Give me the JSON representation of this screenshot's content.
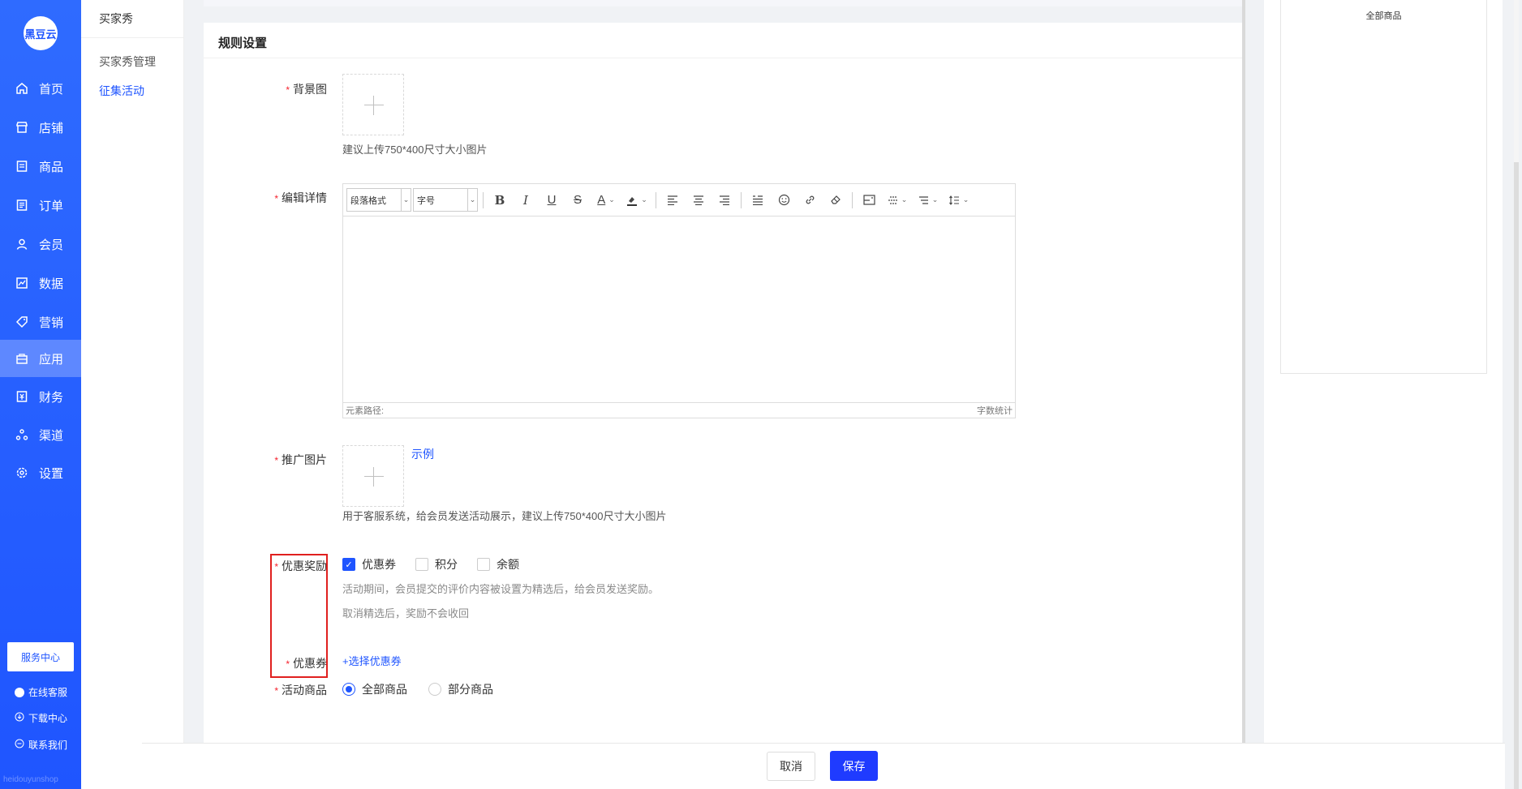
{
  "nav": {
    "logo": "黑豆云",
    "items": [
      {
        "label": "首页",
        "icon": "home-icon"
      },
      {
        "label": "店铺",
        "icon": "store-icon"
      },
      {
        "label": "商品",
        "icon": "goods-icon"
      },
      {
        "label": "订单",
        "icon": "order-icon"
      },
      {
        "label": "会员",
        "icon": "member-icon"
      },
      {
        "label": "数据",
        "icon": "data-icon"
      },
      {
        "label": "营销",
        "icon": "tag-icon"
      },
      {
        "label": "应用",
        "icon": "app-icon",
        "active": true
      },
      {
        "label": "财务",
        "icon": "finance-icon"
      },
      {
        "label": "渠道",
        "icon": "channel-icon"
      },
      {
        "label": "设置",
        "icon": "gear-icon"
      }
    ],
    "service_center": "服务中心",
    "online_service": "在线客服",
    "download_center": "下载中心",
    "contact_us": "联系我们",
    "watermark": "heidouyunshop"
  },
  "subnav": {
    "title": "买家秀",
    "items": [
      {
        "label": "买家秀管理",
        "active": false
      },
      {
        "label": "征集活动",
        "active": true
      }
    ]
  },
  "form": {
    "section_title": "规则设置",
    "background_label": "背景图",
    "background_hint": "建议上传750*400尺寸大小图片",
    "detail_label": "编辑详情",
    "editor": {
      "paragraph_select": "段落格式",
      "fontsize_select": "字号",
      "footer_path": "元素路径:",
      "footer_count": "字数统计"
    },
    "promo_label": "推广图片",
    "promo_example": "示例",
    "promo_hint": "用于客服系统，给会员发送活动展示，建议上传750*400尺寸大小图片",
    "reward_label": "优惠奖励",
    "reward_options": [
      {
        "label": "优惠券",
        "checked": true
      },
      {
        "label": "积分",
        "checked": false
      },
      {
        "label": "余额",
        "checked": false
      }
    ],
    "reward_hint_1": "活动期间，会员提交的评价内容被设置为精选后，给会员发送奖励。",
    "reward_hint_2": "取消精选后，奖励不会收回",
    "coupon_label": "优惠券",
    "coupon_select": "+选择优惠券",
    "goods_label": "活动商品",
    "goods_options": [
      {
        "label": "全部商品",
        "selected": true
      },
      {
        "label": "部分商品",
        "selected": false
      }
    ]
  },
  "preview": {
    "text": "全部商品"
  },
  "footer": {
    "cancel": "取消",
    "save": "保存"
  },
  "colors": {
    "brand": "#1f55ff",
    "required": "#f5222d",
    "highlight_box": "#e0201f"
  }
}
